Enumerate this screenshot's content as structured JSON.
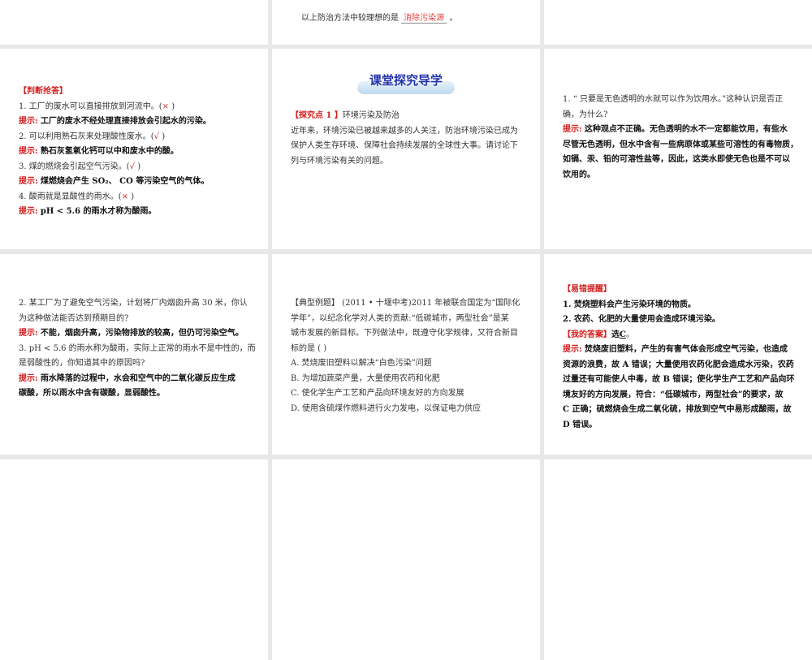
{
  "top_middle": {
    "line": "以上防治方法中较理想的是",
    "answer": "消除污染源",
    "end": "。"
  },
  "judge": {
    "heading": "【判断抢答】",
    "items": [
      {
        "q": "1. 工厂的废水可以直接排放到河流中。(",
        "mark": "×",
        "close": ")",
        "hint_label": "提示:",
        "hint": "工厂的废水不经处理直接排放会引起水的污染。"
      },
      {
        "q": "2. 可以利用熟石灰来处理酸性废水。(",
        "mark": "√",
        "close": ")",
        "hint_label": "提示:",
        "hint": "熟石灰氢氧化钙可以中和废水中的酸。"
      },
      {
        "q": "3. 煤的燃烧会引起空气污染。(",
        "mark": "√",
        "close": ")",
        "hint_label": "提示:",
        "hint": "煤燃烧会产生 SO₂、 CO 等污染空气的气体。"
      },
      {
        "q": "4. 酸雨就是显酸性的雨水。(",
        "mark": "×",
        "close": ")",
        "hint_label": "提示:",
        "hint": "pH < 5.6 的雨水才称为酸雨。"
      }
    ]
  },
  "explore": {
    "title": "课堂探究导学",
    "point_label": "【探究点 1 】",
    "point": "环境污染及防治",
    "lines": [
      "近年来，环境污染已被越来越多的人关注，防治环境污染已成为",
      "保护人类生存环境、保障社会持续发展的全球性大事。请讨论下",
      "列与环境污染有关的问题。"
    ]
  },
  "q1": {
    "lines": [
      "1. “ 只要是无色透明的水就可以作为饮用水。”这种认识是否正",
      "确，为什么?"
    ],
    "hint_label": "提示:",
    "hint": [
      "这种观点不正确。无色透明的水不一定都能饮用，有些水",
      "尽管无色透明，但水中含有一些病原体或某些可溶性的有毒物质，",
      "如镉、汞、铅的可溶性盐等，因此，这类水即使无色也是不可以",
      "饮用的。"
    ]
  },
  "q23": {
    "q2": [
      "2. 某工厂为了避免空气污染，计划将厂内烟囱升高 30 米，你认",
      "为这种做法能否达到预期目的?"
    ],
    "hint_label": "提示:",
    "hint2": "不能，烟囱升高，污染物排放的较高，但仍可污染空气。",
    "q3": [
      "3. pH < 5.6 的雨水称为酸雨，实际上正常的雨水不是中性的，而",
      "是弱酸性的，你知道其中的原因吗?"
    ],
    "hint3": [
      "雨水降落的过程中，水会和空气中的二氧化碳反应生成",
      "碳酸，所以雨水中含有碳酸，显弱酸性。"
    ]
  },
  "example": {
    "lines": [
      "【典型例题】 (2011 • 十堰中考)2011 年被联合国定为“国际化",
      "学年”，以纪念化学对人类的贡献:“低碳城市，两型社会”是某",
      "城市发展的新目标。下列做法中，既遵守化学规律，又符合新目",
      "标的是 (        )"
    ],
    "options": [
      "A. 焚烧废旧塑料以解决“白色污染”问题",
      "B. 为增加蔬菜产量，大量使用农药和化肥",
      "C. 使化学生产工艺和产品向环境友好的方向发展",
      "D. 使用含硫煤作燃料进行火力发电，以保证电力供应"
    ]
  },
  "answer": {
    "heading": "【易错提醒】",
    "tips": [
      "1. 焚烧塑料会产生污染环境的物质。",
      "2. 农药、化肥的大量使用会造成环境污染。"
    ],
    "mine_label": "【我的答案】",
    "mine_pre": "选",
    "mine": "C",
    "mine_end": "。",
    "hint_label": "提示:",
    "hint": [
      "焚烧废旧塑料，产生的有害气体会形成空气污染，也造成",
      "资源的浪费，故 A 错误；大量使用农药化肥会造成水污染，农药",
      "过量还有可能使人中毒，故 B 错误；使化学生产工艺和产品向环",
      "境友好的方向发展，符合：“低碳城市，两型社会”的要求，故",
      "C 正确；硫燃烧会生成二氧化硫，排放到空气中易形成酸雨，故",
      "D 错误。"
    ]
  }
}
